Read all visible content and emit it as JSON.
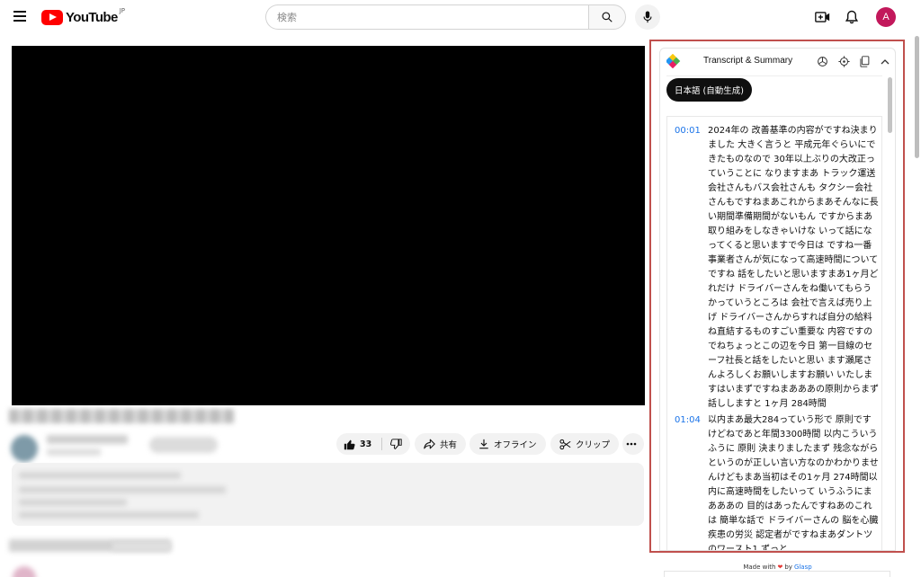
{
  "header": {
    "logo_text": "YouTube",
    "logo_region": "JP",
    "search_placeholder": "検索",
    "avatar_letter": "A"
  },
  "actions": {
    "like_count": "33",
    "share_label": "共有",
    "offline_label": "オフライン",
    "clip_label": "クリップ"
  },
  "panel": {
    "title": "Transcript & Summary",
    "language_button": "日本語 (自動生成)",
    "segments": [
      {
        "time": "00:01",
        "text": "2024年の 改善基準の内容がですね決まりました 大きく言うと 平成元年ぐらいにできたものなので 30年以上ぶりの大改正っていうことに なりますまあ トラック運送会社さんもバス会社さんも タクシー会社さんもですねまあこれからまあそんなに長い期間準備期間がないもん ですからまあ取り組みをしなきゃいけな いって話になってくると思いますで今日は ですね一番 事業者さんが気になって高速時間について ですね 話をしたいと思いますまあ1ヶ月どれだけ ドライバーさんをね働いてもらうかっていうところは 会社で言えば売り上げ ドライバーさんからすれば自分の給料ね直結するものすごい重要な 内容ですのでねちょっとこの辺を今日 第一目線のセーフ社長と話をしたいと思い ます瀬尾さんよろしくお願いしますお願い いたしますはいまずですねまあああの原則からまず話ししますと 1ヶ月 284時間"
      },
      {
        "time": "01:04",
        "text": "以内まあ最大284っていう形で 原則ですけどねであと年間3300時間 以内こういうふうに 原則 決まりましたまず 残念ながらというのが正しい言い方なのかわかりませんけどもまあ当初はその1ヶ月 274時間以内に高速時間をしたいって いうふうにまあああの 目的はあったんですねあのこれは 簡単な話で ドライバーさんの 脳を心臓疾患の労災 認定者がですねまあダントツのワースト1 ずっと"
      }
    ],
    "footer_made_with": "Made with",
    "footer_by": "by",
    "footer_link": "Glasp"
  }
}
